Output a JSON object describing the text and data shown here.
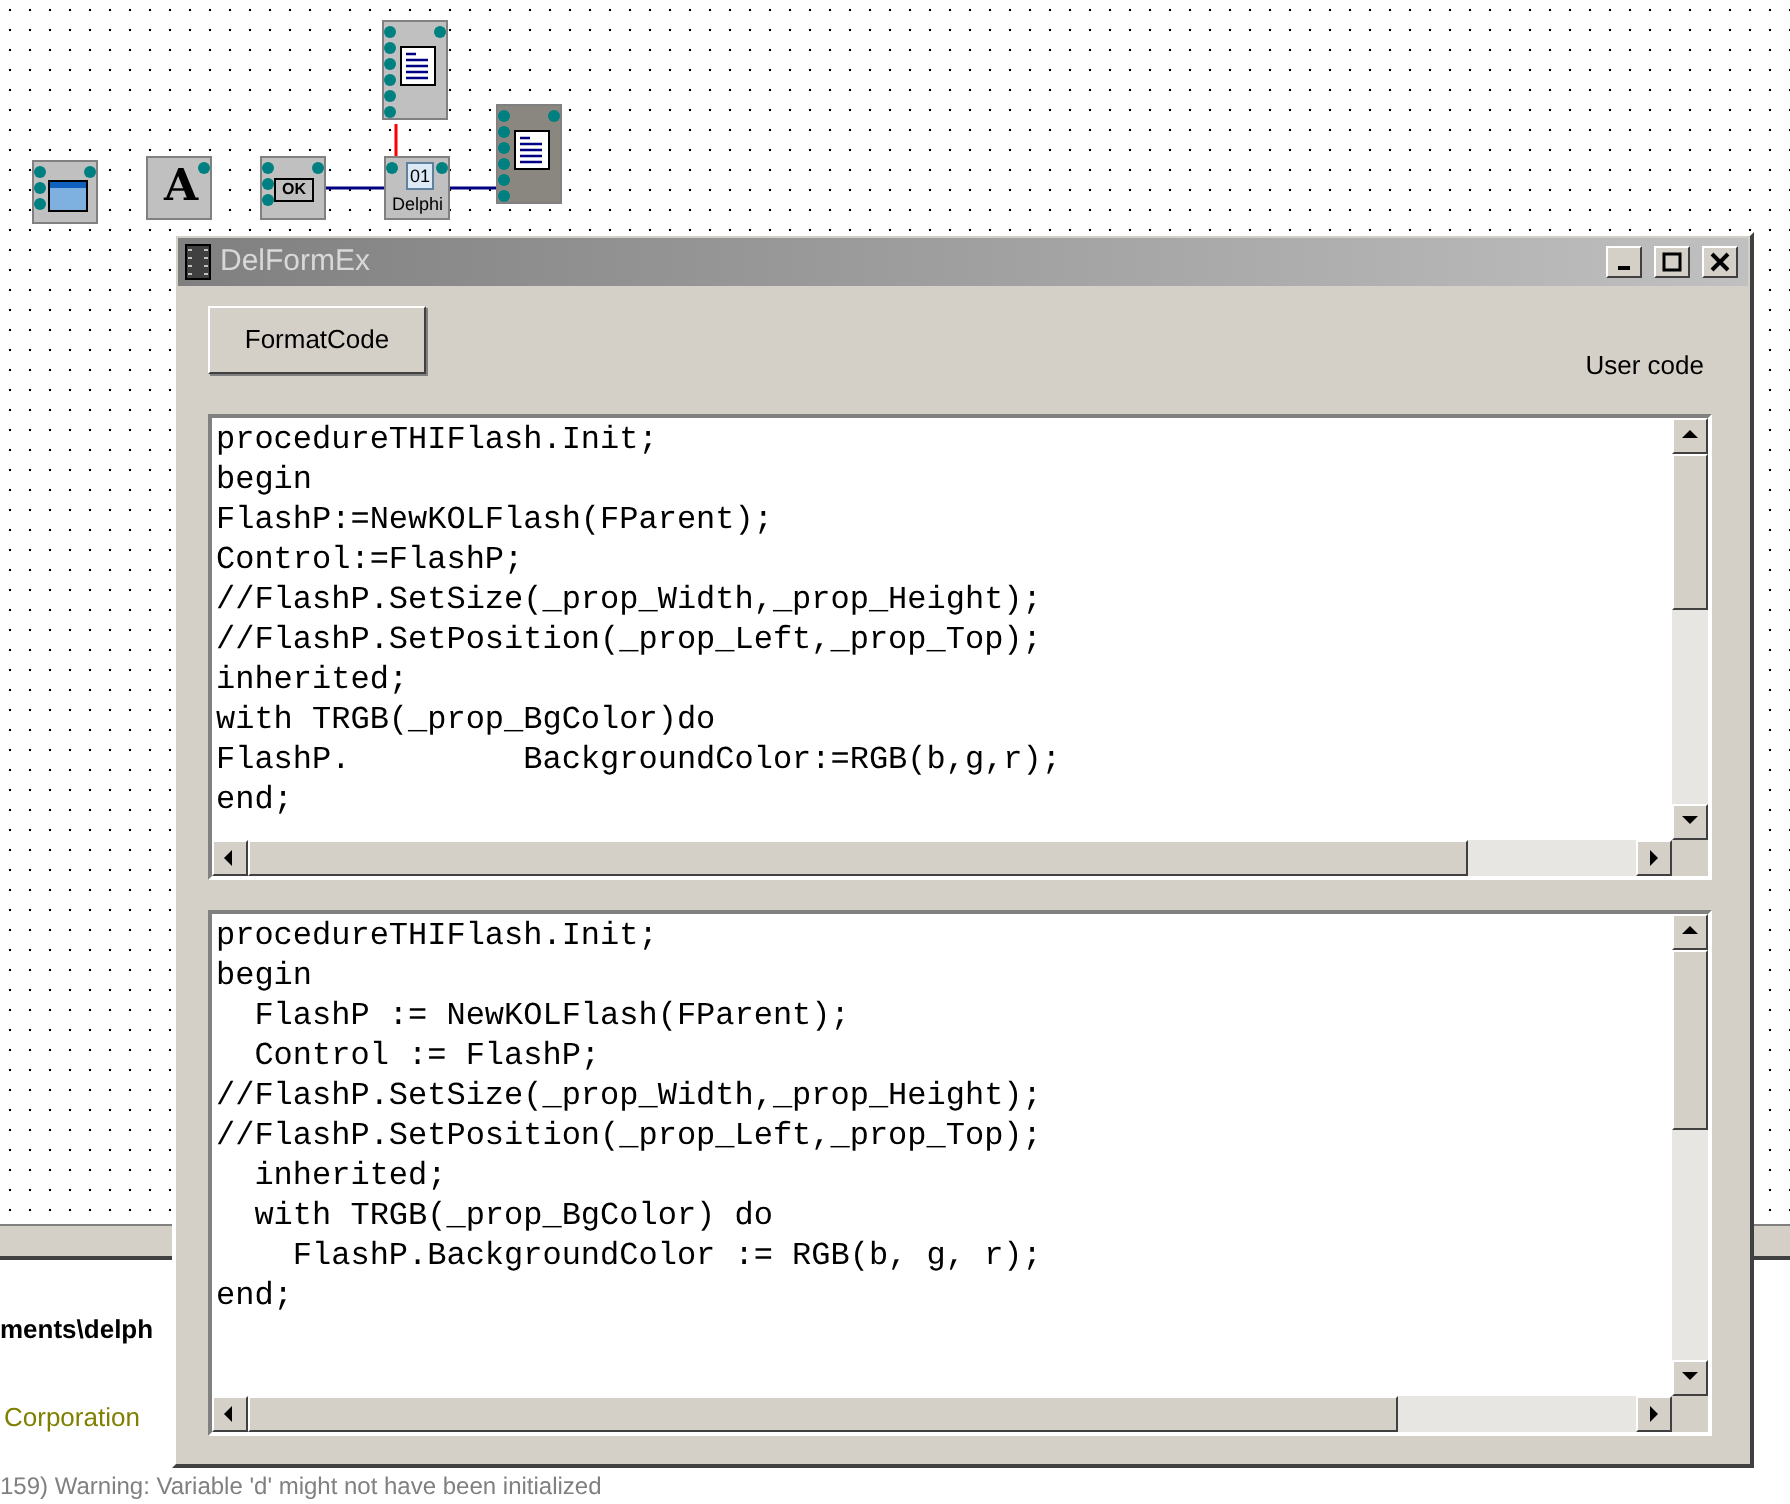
{
  "canvas": {
    "nodes": [
      {
        "kind": "form",
        "selected": false
      },
      {
        "kind": "label",
        "glyph": "A",
        "selected": false
      },
      {
        "kind": "button",
        "glyph": "OK",
        "selected": false
      },
      {
        "kind": "delphi",
        "glyph": "01",
        "label": "Delphi",
        "selected": false
      },
      {
        "kind": "memo",
        "selected": false
      },
      {
        "kind": "memo",
        "selected": true
      }
    ]
  },
  "background_text": [
    {
      "kind": "path",
      "text": "ments\\delph"
    },
    {
      "kind": "company",
      "text": "Corporation"
    },
    {
      "kind": "message",
      "text": "159) Warning: Variable 'd' might not have been initialized"
    }
  ],
  "window": {
    "title": "DelFormEx",
    "button": "FormatCode",
    "label": "User code",
    "editors": [
      {
        "lines": [
          "procedureTHIFlash.Init;",
          "begin",
          "FlashP:=NewKOLFlash(FParent);",
          "Control:=FlashP;",
          "//FlashP.SetSize(_prop_Width,_prop_Height);",
          "//FlashP.SetPosition(_prop_Left,_prop_Top);",
          "inherited;",
          "with TRGB(_prop_BgColor)do",
          "FlashP.         BackgroundColor:=RGB(b,g,r);",
          "end;"
        ]
      },
      {
        "lines": [
          "procedureTHIFlash.Init;",
          "begin",
          "  FlashP := NewKOLFlash(FParent);",
          "  Control := FlashP;",
          "//FlashP.SetSize(_prop_Width,_prop_Height);",
          "//FlashP.SetPosition(_prop_Left,_prop_Top);",
          "  inherited;",
          "  with TRGB(_prop_BgColor) do",
          "    FlashP.BackgroundColor := RGB(b, g, r);",
          "end;"
        ]
      }
    ]
  }
}
